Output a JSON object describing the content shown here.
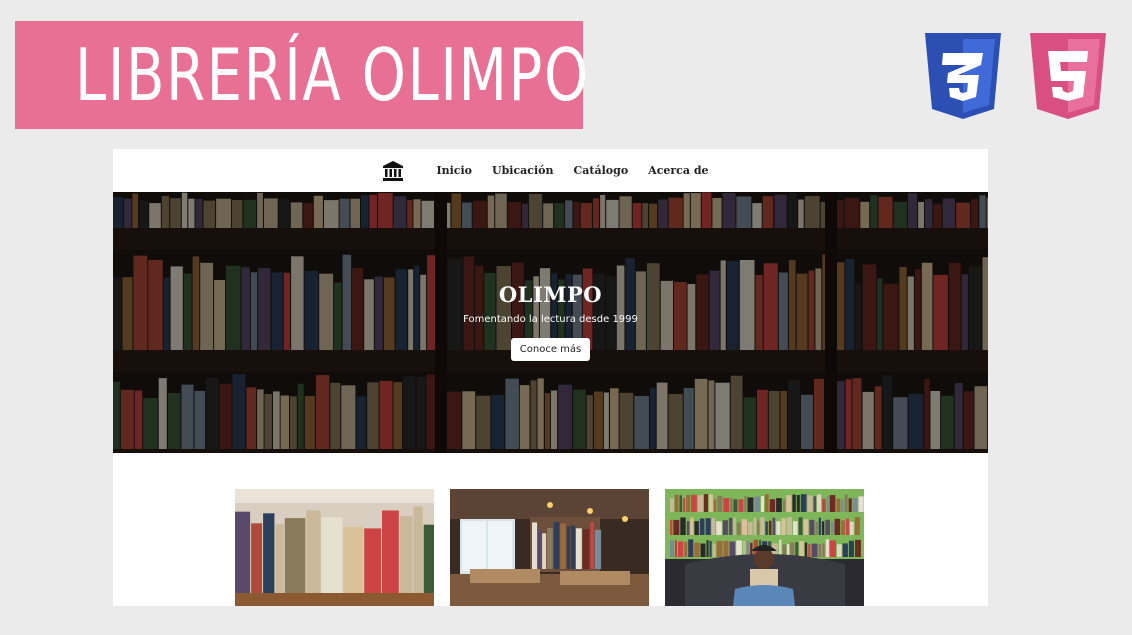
{
  "banner": {
    "title": "LIBRERÍA OLIMPO"
  },
  "logos": {
    "css_icon": "css3-logo",
    "html_icon": "html5-logo",
    "css_color": "#2b4fb3",
    "html_color": "#e5588a"
  },
  "nav": {
    "brand_icon": "temple-icon",
    "items": [
      "Inicio",
      "Ubicación",
      "Catálogo",
      "Acerca de"
    ]
  },
  "hero": {
    "title": "OLIMPO",
    "subtitle": "Fomentando la lectura desde 1999",
    "cta": "Conoce más"
  },
  "cards": [
    {
      "image": "bookshelf-closeup-photo"
    },
    {
      "image": "bookstore-interior-photo"
    },
    {
      "image": "woman-reading-photo"
    }
  ],
  "colors": {
    "banner": "#e87094",
    "page_bg": "#ebebeb"
  }
}
